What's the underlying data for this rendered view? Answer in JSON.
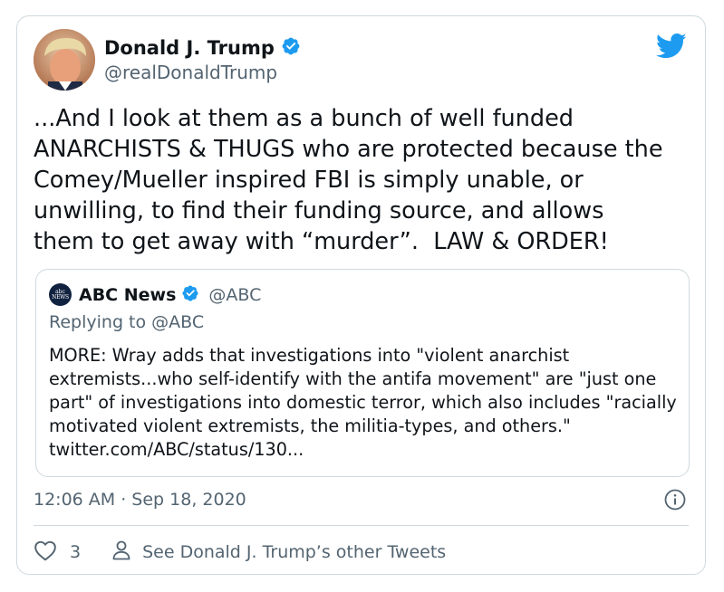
{
  "author": {
    "name": "Donald J. Trump",
    "handle": "@realDonaldTrump"
  },
  "tweet": {
    "text": "...And I look at them as a bunch of well funded\nANARCHISTS & THUGS who are protected because the\nComey/Mueller inspired FBI is simply unable, or\nunwilling, to find their funding source, and allows\nthem to get away with “murder”.  LAW & ORDER!"
  },
  "quoted_tweet": {
    "logo_text_top": "abc",
    "logo_text_bottom": "NEWS",
    "name": "ABC News",
    "handle": "@ABC",
    "replying_to": "Replying to @ABC",
    "text": "MORE: Wray adds that investigations into \"violent anarchist extremists...who self-identify with the antifa movement\" are \"just one part\" of investigations into domestic terror, which also includes \"racially motivated violent extremists, the militia-types, and others.\" twitter.com/ABC/status/130..."
  },
  "meta": {
    "timestamp": "12:06 AM · Sep 18, 2020"
  },
  "actions": {
    "like_count": "3",
    "see_other": "See Donald J. Trump’s other Tweets"
  },
  "icons": {
    "verified": "verified-badge-icon",
    "brand": "twitter-bird-icon",
    "info": "info-icon",
    "like": "heart-icon",
    "profile": "person-icon"
  },
  "colors": {
    "brand_blue": "#1d9bf0",
    "text": "#0f1419",
    "secondary": "#536471",
    "border": "#cfd9de"
  }
}
